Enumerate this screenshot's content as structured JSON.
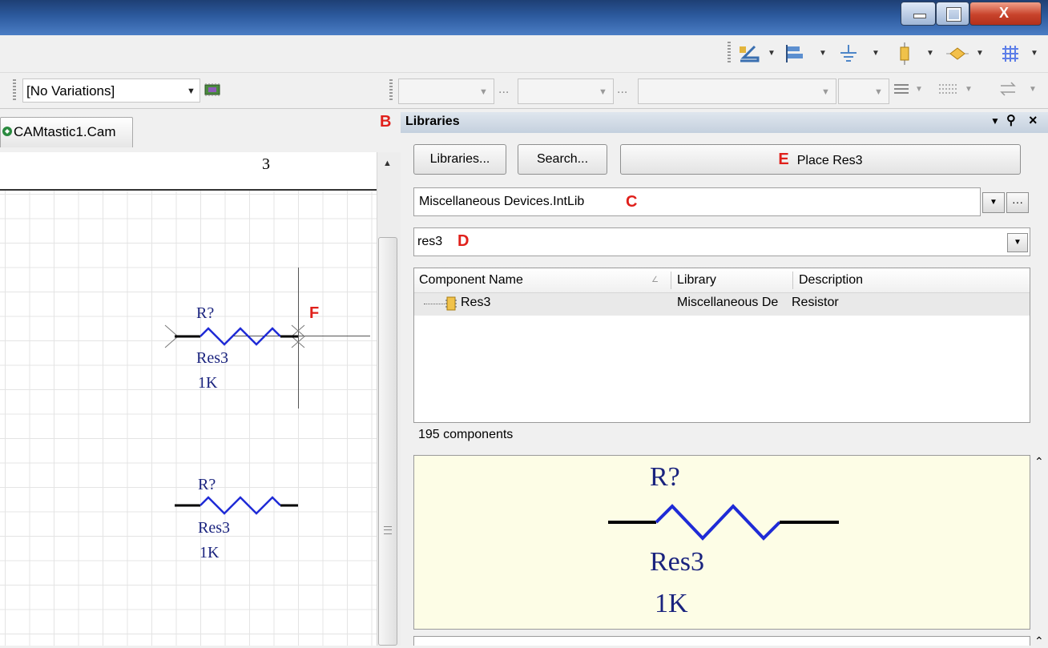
{
  "window": {
    "minimize_glyph": "—",
    "maximize_glyph": "❐",
    "close_glyph": "X"
  },
  "toolbar": {
    "variations_select": "[No Variations]",
    "ellipsis_1": "...",
    "ellipsis_2": "..."
  },
  "document": {
    "tab_label": "CAMtastic1.Cam",
    "ruler_label": "3",
    "resistor_upper": {
      "designator": "R?",
      "comment": "Res3",
      "value": "1K"
    },
    "resistor_lower": {
      "designator": "R?",
      "comment": "Res3",
      "value": "1K"
    }
  },
  "annotations": {
    "b": "B",
    "c": "C",
    "d": "D",
    "e": "E",
    "f": "F"
  },
  "libraries_panel": {
    "title": "Libraries",
    "libraries_button": "Libraries...",
    "search_button": "Search...",
    "place_button": "Place Res3",
    "library_select": "Miscellaneous Devices.IntLib",
    "filter_value": "res3",
    "columns": [
      "Component Name",
      "Library",
      "Description"
    ],
    "rows": [
      {
        "name": "Res3",
        "library": "Miscellaneous De",
        "description": "Resistor"
      }
    ],
    "count_text": "195 components",
    "preview": {
      "designator": "R?",
      "comment": "Res3",
      "value": "1K"
    }
  },
  "colors": {
    "schematic_text": "#1a237e",
    "resistor_zigzag": "#1f2bd6",
    "annotation_red": "#e0201b",
    "preview_background": "#fdfde6"
  },
  "icons": [
    "minimize-icon",
    "maximize-icon",
    "close-icon",
    "wire-tool-icon",
    "align-icon",
    "ground-icon",
    "part-icon",
    "port-icon",
    "grid-icon",
    "pcb-chip-icon",
    "library-component-icon"
  ]
}
